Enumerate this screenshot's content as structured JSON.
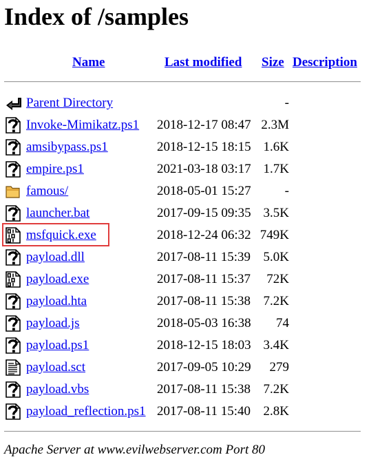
{
  "page": {
    "title": "Index of /samples"
  },
  "columns": {
    "name": "Name",
    "last_modified": "Last modified",
    "size": "Size",
    "description": "Description"
  },
  "entries": [
    {
      "name": "Parent Directory",
      "date": "",
      "size": "-",
      "icon": "back-arrow-icon"
    },
    {
      "name": "Invoke-Mimikatz.ps1",
      "date": "2018-12-17 08:47",
      "size": "2.3M",
      "icon": "unknown-file-icon"
    },
    {
      "name": "amsibypass.ps1",
      "date": "2018-12-15 18:15",
      "size": "1.6K",
      "icon": "unknown-file-icon"
    },
    {
      "name": "empire.ps1",
      "date": "2021-03-18 03:17",
      "size": "1.7K",
      "icon": "unknown-file-icon"
    },
    {
      "name": "famous/",
      "date": "2018-05-01 15:27",
      "size": "-",
      "icon": "folder-icon"
    },
    {
      "name": "launcher.bat",
      "date": "2017-09-15 09:35",
      "size": "3.5K",
      "icon": "unknown-file-icon"
    },
    {
      "name": "msfquick.exe",
      "date": "2018-12-24 06:32",
      "size": "749K",
      "icon": "binary-file-icon",
      "highlighted": true
    },
    {
      "name": "payload.dll",
      "date": "2017-08-11 15:39",
      "size": "5.0K",
      "icon": "unknown-file-icon"
    },
    {
      "name": "payload.exe",
      "date": "2017-08-11 15:37",
      "size": "72K",
      "icon": "binary-file-icon"
    },
    {
      "name": "payload.hta",
      "date": "2017-08-11 15:38",
      "size": "7.2K",
      "icon": "unknown-file-icon"
    },
    {
      "name": "payload.js",
      "date": "2018-05-03 16:38",
      "size": "74",
      "icon": "unknown-file-icon"
    },
    {
      "name": "payload.ps1",
      "date": "2018-12-15 18:03",
      "size": "3.4K",
      "icon": "unknown-file-icon"
    },
    {
      "name": "payload.sct",
      "date": "2017-09-05 10:29",
      "size": "279",
      "icon": "text-file-icon"
    },
    {
      "name": "payload.vbs",
      "date": "2017-08-11 15:38",
      "size": "7.2K",
      "icon": "unknown-file-icon"
    },
    {
      "name": "payload_reflection.ps1",
      "date": "2017-08-11 15:40",
      "size": "2.8K",
      "icon": "unknown-file-icon"
    }
  ],
  "footer": {
    "address": "Apache Server at www.evilwebserver.com Port 80"
  },
  "colors": {
    "link": "#0000ee",
    "highlight_box": "#e03c3c",
    "rule": "#9a9a9a"
  }
}
